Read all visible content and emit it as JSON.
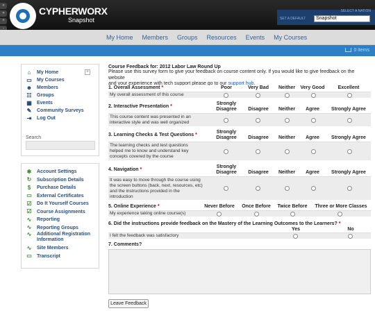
{
  "header": {
    "logo": "CYPHERWORX",
    "logo_sub": "Snapshot",
    "select_nation": "SELECT A NATION",
    "set_account_label": "SET A DEFAULT",
    "account_value": "Snapshot",
    "side_buttons": [
      "«",
      "»",
      "+",
      "-"
    ]
  },
  "nav": {
    "items": [
      "My Home",
      "Members",
      "Groups",
      "Resources",
      "Events",
      "My Courses"
    ],
    "cart": "0 items"
  },
  "sidebar": {
    "main_items": [
      {
        "label": "My Home",
        "icon": "⌂"
      },
      {
        "label": "My Courses",
        "icon": "▭"
      },
      {
        "label": "Members",
        "icon": "☻"
      },
      {
        "label": "Groups",
        "icon": "☷"
      },
      {
        "label": "Events",
        "icon": "▦"
      },
      {
        "label": "Community Surveys",
        "icon": "✎"
      },
      {
        "label": "Log Out",
        "icon": "⇥"
      }
    ],
    "search_label": "Search",
    "account_items": [
      {
        "label": "Account Settings",
        "icon": "✱"
      },
      {
        "label": "Subscription Details",
        "icon": "↻"
      },
      {
        "label": "Purchase Details",
        "icon": "$"
      },
      {
        "label": "External Certificates",
        "icon": "▭"
      },
      {
        "label": "Do It Yourself Courses",
        "icon": "☑"
      },
      {
        "label": "Course Assignments",
        "icon": "☑"
      },
      {
        "label": "Reporting",
        "icon": "∿"
      },
      {
        "label": "Reporting Groups",
        "icon": "∿"
      },
      {
        "label": "Additional Registration Information",
        "icon": "∿"
      },
      {
        "label": "Site Members",
        "icon": "∿"
      },
      {
        "label": "Transcript",
        "icon": "▭"
      }
    ]
  },
  "survey": {
    "title": "Course Feedback for: 2012 Labor Law Round Up",
    "intro_1": "Please use this survey form to give your feedback on course content only. If you would like to give feedback on the website",
    "intro_2": "and your experience with tech support please go to our",
    "link": "support hub",
    "q1": {
      "title": "1. Overall Assessment",
      "cols": [
        "Poor",
        "Very Bad",
        "Neither",
        "Very Good",
        "Excellent"
      ],
      "stmt": "My overall assessment of this course"
    },
    "q2": {
      "title": "2. Interactive Presentation",
      "col1_a": "Strongly",
      "col1_b": "Disagree",
      "cols": [
        "Disagree",
        "Neither",
        "Agree",
        "Strongly Agree"
      ],
      "stmt_a": "This course content was presented in an",
      "stmt_b": "interactive style and was well organized"
    },
    "q3": {
      "title": "3. Learning Checks & Test Questions",
      "col1_a": "Strongly",
      "col1_b": "Disagree",
      "cols": [
        "Disagree",
        "Neither",
        "Agree",
        "Strongly Agree"
      ],
      "stmt_a": "The learning checks and test questions",
      "stmt_b": "helped me to know and understand key",
      "stmt_c": "concepts covered by the course"
    },
    "q4": {
      "title": "4. Navigation",
      "col1_a": "Strongly",
      "col1_b": "Disagree",
      "cols": [
        "Disagree",
        "Neither",
        "Agree",
        "Strongly Agree"
      ],
      "stmt_a": "It was easy to move through the course using",
      "stmt_b": "the screen buttons (back, next, resources, etc)",
      "stmt_c": "and the instructions provided in the",
      "stmt_d": "introduction"
    },
    "q5": {
      "title": "5. Online Experience",
      "cols": [
        "Never Before",
        "Once Before",
        "Twice Before",
        "Three or More Classes"
      ],
      "stmt": "My experience taking online course(s)"
    },
    "q6": {
      "title": "6. Did the instructions provide feedback on the Mastery of the Learning Outcomes to the Learners?",
      "cols": [
        "Yes",
        "No"
      ],
      "stmt": "I felt the feedback was satisfactory"
    },
    "q7": {
      "title": "7. Comments?"
    },
    "required_mark": "*",
    "button": "Leave Feedback"
  }
}
